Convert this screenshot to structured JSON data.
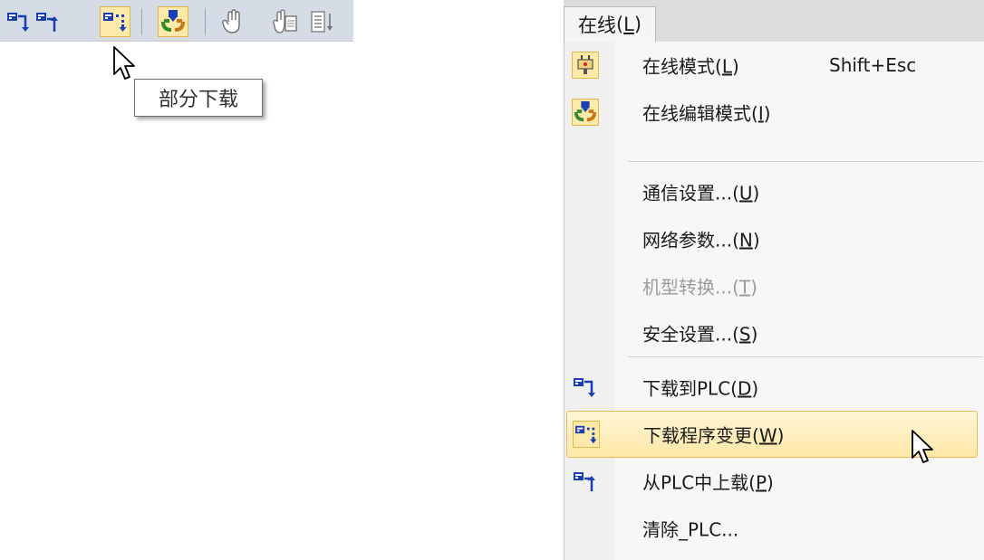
{
  "toolbar": {
    "buttons": [
      {
        "icon": "download-to-plc-icon",
        "highlighted": false
      },
      {
        "icon": "upload-from-plc-icon",
        "highlighted": false
      },
      {
        "icon": "partial-download-icon",
        "highlighted": true
      },
      {
        "icon": "online-edit-mode-icon",
        "highlighted": true
      },
      {
        "icon": "hand-icon",
        "highlighted": false
      },
      {
        "icon": "hand-page-icon",
        "highlighted": false
      },
      {
        "icon": "list-down-icon",
        "highlighted": false
      }
    ],
    "tooltip": "部分下载"
  },
  "menu": {
    "title": "在线",
    "title_mnemonic": "L",
    "items": [
      {
        "label": "在线模式",
        "mnemonic": "L",
        "shortcut": "Shift+Esc",
        "icon": "plug-icon"
      },
      {
        "label": "在线编辑模式",
        "mnemonic": "I",
        "icon": "online-edit-mode-icon"
      },
      {
        "label": "通信设置...",
        "mnemonic": "U"
      },
      {
        "label": "网络参数...",
        "mnemonic": "N"
      },
      {
        "label": "机型转换...",
        "mnemonic": "T",
        "disabled": true
      },
      {
        "label": "安全设置...",
        "mnemonic": "S"
      },
      {
        "label": "下载到PLC",
        "mnemonic": "D",
        "icon": "download-to-plc-icon"
      },
      {
        "label": "下载程序变更",
        "mnemonic": "W",
        "icon": "partial-download-icon",
        "hovered": true
      },
      {
        "label": "从PLC中上载",
        "mnemonic": "P",
        "icon": "upload-from-plc-icon"
      },
      {
        "label": "清除_PLC..."
      }
    ]
  },
  "colors": {
    "toolbar_bg": "#d6dce5",
    "highlight_fill": "#fde9a8",
    "highlight_border": "#e3b54a",
    "icon_blue": "#1a3fb5",
    "disabled_text": "#9c9c9c"
  }
}
